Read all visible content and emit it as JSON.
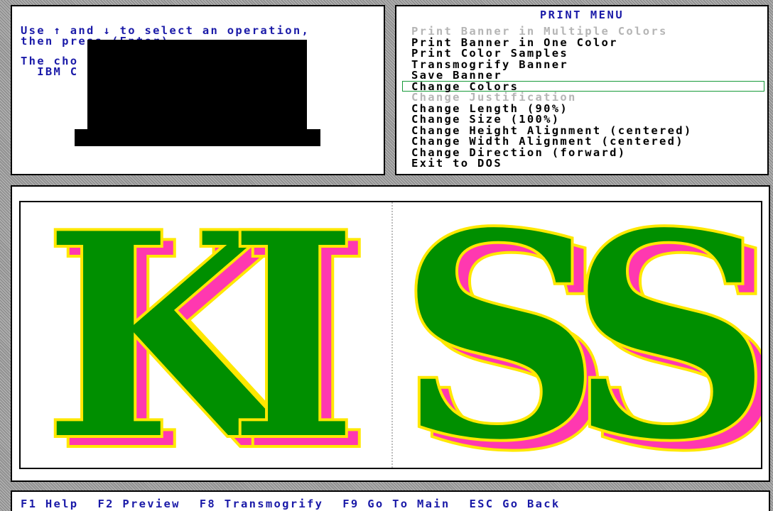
{
  "help": {
    "lines": [
      "Use ↑ and ↓ to select an operation,",
      "then press (Enter).",
      "The cho",
      "  IBM C"
    ]
  },
  "menu": {
    "title": "PRINT MENU",
    "items": [
      {
        "label": "Print Banner in Multiple Colors",
        "disabled": true,
        "selected": false
      },
      {
        "label": "Print Banner in One Color",
        "disabled": false,
        "selected": false
      },
      {
        "label": "Print Color Samples",
        "disabled": false,
        "selected": false
      },
      {
        "label": "Transmogrify Banner",
        "disabled": false,
        "selected": false
      },
      {
        "label": "Save Banner",
        "disabled": false,
        "selected": false
      },
      {
        "label": "Change Colors",
        "disabled": false,
        "selected": true
      },
      {
        "label": "Change Justification",
        "disabled": true,
        "selected": false
      },
      {
        "label": "Change Length (90%)",
        "disabled": false,
        "selected": false
      },
      {
        "label": "Change Size (100%)",
        "disabled": false,
        "selected": false
      },
      {
        "label": "Change Height Alignment (centered)",
        "disabled": false,
        "selected": false
      },
      {
        "label": "Change Width Alignment (centered)",
        "disabled": false,
        "selected": false
      },
      {
        "label": "Change Direction (forward)",
        "disabled": false,
        "selected": false
      },
      {
        "label": "Exit to DOS",
        "disabled": false,
        "selected": false
      }
    ]
  },
  "preview": {
    "banner_text": "KISS",
    "colors": {
      "fill": "#008f00",
      "shadow": "#ff38b0",
      "outline": "#ffe800"
    }
  },
  "function_keys": [
    {
      "key": "F1",
      "label": "Help"
    },
    {
      "key": "F2",
      "label": "Preview"
    },
    {
      "key": "F8",
      "label": "Transmogrify"
    },
    {
      "key": "F9",
      "label": "Go To Main"
    },
    {
      "key": "ESC",
      "label": "Go Back"
    }
  ],
  "colors": {
    "help_text": "#1a1aa8",
    "menu_text": "#000000",
    "disabled_text": "#b5b5b5",
    "selection_border": "#189a3a"
  }
}
